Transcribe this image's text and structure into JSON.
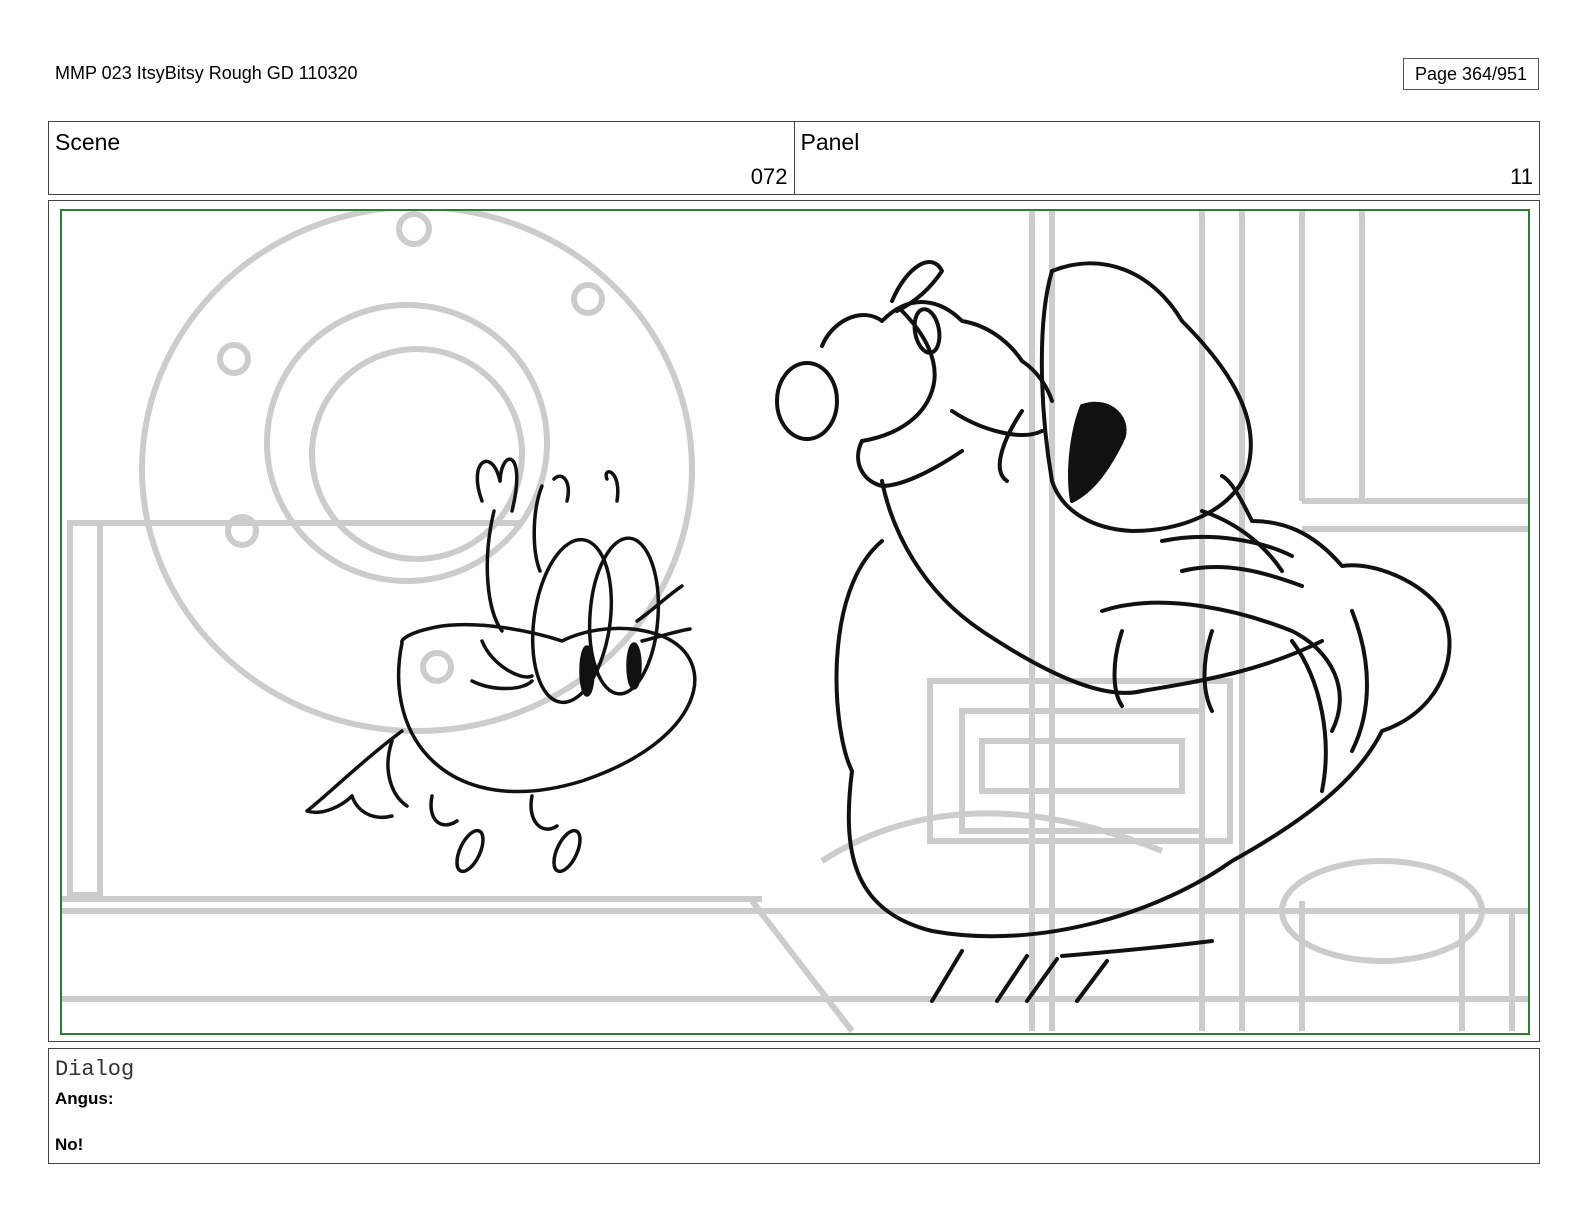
{
  "document": {
    "title": "MMP 023 ItsyBitsy Rough GD 110320",
    "page": "Page 364/951"
  },
  "header": {
    "scene_label": "Scene",
    "scene_value": "072",
    "panel_label": "Panel",
    "panel_value": "11"
  },
  "frame": {
    "border_color": "#2e7d32",
    "background_line_color": "#cccccc",
    "ink_color": "#111111"
  },
  "dialog": {
    "label": "Dialog",
    "speaker": "Angus:",
    "line": "No!"
  }
}
